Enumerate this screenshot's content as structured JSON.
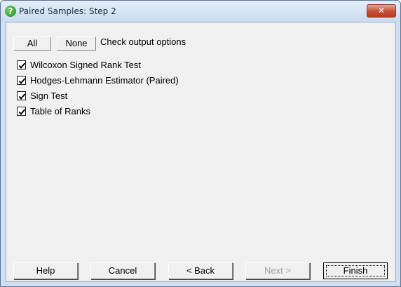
{
  "window": {
    "title": "Paired Samples: Step 2",
    "close_icon_glyph": "✕",
    "help_icon_glyph": "?"
  },
  "toolbar": {
    "all_label": "All",
    "none_label": "None",
    "check_label": "Check output options"
  },
  "options": [
    {
      "label": "Wilcoxon Signed Rank Test",
      "checked": true
    },
    {
      "label": "Hodges-Lehmann Estimator (Paired)",
      "checked": true
    },
    {
      "label": "Sign Test",
      "checked": true
    },
    {
      "label": "Table of Ranks",
      "checked": true
    }
  ],
  "buttons": {
    "help": "Help",
    "cancel": "Cancel",
    "back": "< Back",
    "next": "Next >",
    "finish": "Finish"
  }
}
